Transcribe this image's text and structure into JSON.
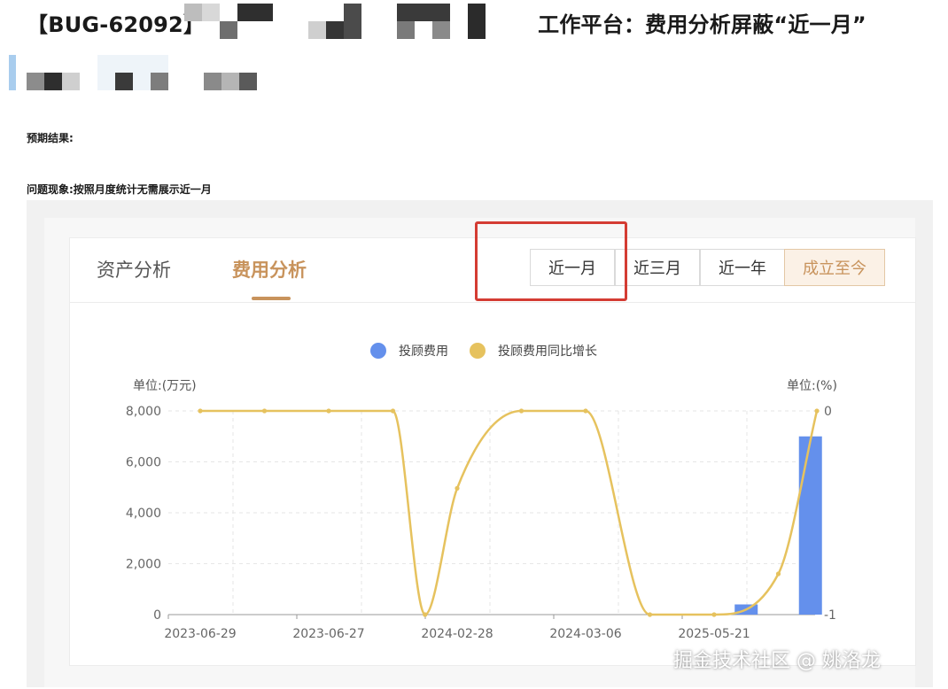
{
  "issue": {
    "id": "【BUG-62092】",
    "title": "工作平台：费用分析屏蔽“近一月”"
  },
  "expected_label": "预期结果:",
  "problem_text": "问题现象:按照月度统计无需展示近一月",
  "tabs": [
    {
      "label": "资产分析",
      "active": false
    },
    {
      "label": "费用分析",
      "active": true
    }
  ],
  "ranges": [
    {
      "label": "近一月",
      "selected": false
    },
    {
      "label": "近三月",
      "selected": false
    },
    {
      "label": "近一年",
      "selected": false
    },
    {
      "label": "成立至今",
      "selected": true
    }
  ],
  "watermark": "掘金技术社区 @ 姚洛龙",
  "colors": {
    "bar": "#6490ec",
    "line": "#e6c25e",
    "accent": "#c8935c",
    "highlight": "#d43c33"
  },
  "chart_data": {
    "type": "bar",
    "x_tick_labels": [
      "2023-06-29",
      "2023-06-27",
      "2024-02-28",
      "2024-03-06",
      "2025-05-21"
    ],
    "left_axis": {
      "unit_label": "单位:(万元)",
      "ylim": [
        0,
        8000
      ],
      "ticks": [
        "8,000",
        "6,000",
        "4,000",
        "2,000",
        "0"
      ]
    },
    "right_axis": {
      "unit_label": "单位:(%)",
      "ylim": [
        -1,
        0
      ],
      "ticks": [
        "0",
        "-1"
      ]
    },
    "series": [
      {
        "name": "投顾费用",
        "type": "bar",
        "x": [
          8.5,
          9.5
        ],
        "values": [
          400,
          7000
        ]
      },
      {
        "name": "投顾费用同比增长",
        "type": "line",
        "x": [
          0,
          1,
          2,
          3,
          3.5,
          4,
          5,
          6,
          7,
          8,
          9,
          9.6
        ],
        "values": [
          0,
          0,
          0,
          0,
          -1,
          -0.38,
          0,
          0,
          -1,
          -1,
          -0.8,
          0
        ]
      }
    ]
  }
}
